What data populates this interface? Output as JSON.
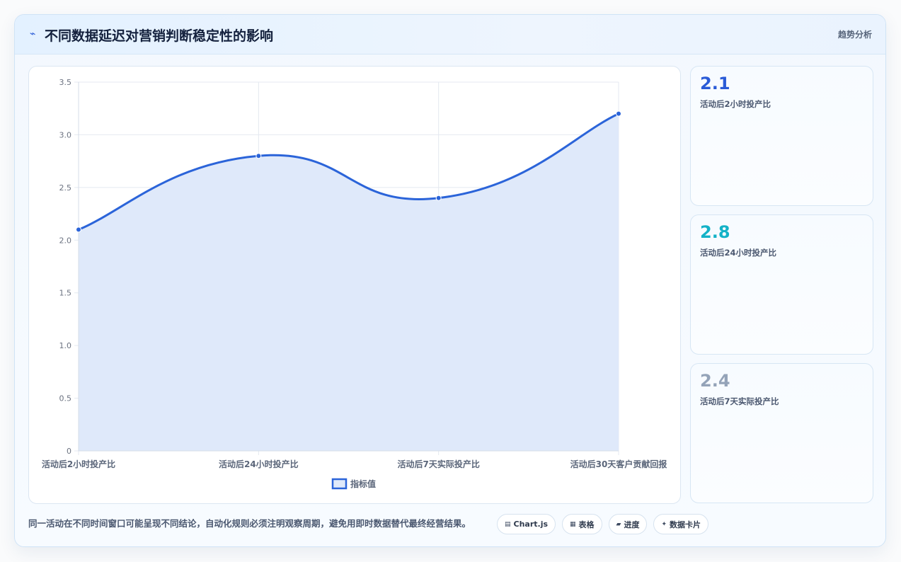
{
  "header": {
    "icon": "trend-icon",
    "title": "不同数据延迟对营销判断稳定性的影响",
    "tag": "趋势分析"
  },
  "colors": {
    "line": "#2b64d9",
    "area": "#dfe9fa",
    "grid": "#e4e9f0",
    "stat1": "#2a5bd7",
    "stat2": "#14b2c7",
    "stat3": "#94a3b8"
  },
  "stats": [
    {
      "value": "2.1",
      "label": "活动后2小时投产比"
    },
    {
      "value": "2.8",
      "label": "活动后24小时投产比"
    },
    {
      "value": "2.4",
      "label": "活动后7天实际投产比"
    }
  ],
  "footer": {
    "note": "同一活动在不同时间窗口可能呈现不同结论，自动化规则必须注明观察周期，避免用即时数据替代最终经营结果。",
    "chips": [
      {
        "icon": "chart-icon",
        "glyph": "▤",
        "label": "Chart.js"
      },
      {
        "icon": "table-icon",
        "glyph": "▦",
        "label": "表格"
      },
      {
        "icon": "progress-icon",
        "glyph": "▰",
        "label": "进度"
      },
      {
        "icon": "sparkle-icon",
        "glyph": "✦",
        "label": "数据卡片"
      }
    ]
  },
  "chart_data": {
    "type": "line",
    "categories": [
      "活动后2小时投产比",
      "活动后24小时投产比",
      "活动后7天实际投产比",
      "活动后30天客户贡献回报"
    ],
    "series": [
      {
        "name": "指标值",
        "values": [
          2.1,
          2.8,
          2.4,
          3.2
        ]
      }
    ],
    "fill": true,
    "smooth": true,
    "ylim": [
      0,
      3.5
    ],
    "yticks": [
      "0",
      "0.5",
      "1.0",
      "1.5",
      "2.0",
      "2.5",
      "3.0",
      "3.5"
    ],
    "grid": true,
    "legend": "bottom"
  }
}
